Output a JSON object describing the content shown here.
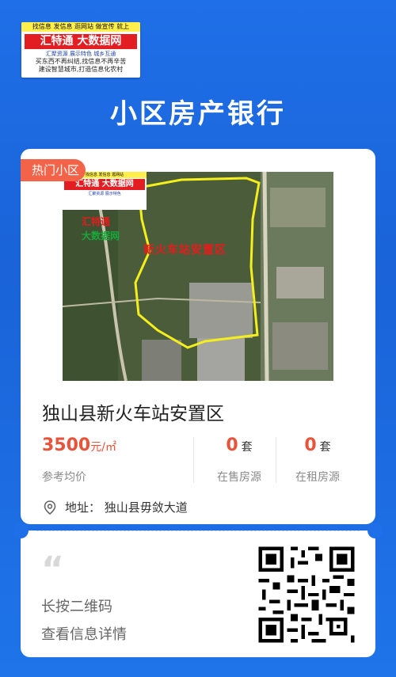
{
  "banner": {
    "line1": "找信息 发信息 逛网站 做宣传 就上",
    "brand": "汇特通 大数据网",
    "line3": "汇聚资源 展示特色 城乡互通",
    "line4": "买东西不再纠结,找信息不再辛苦",
    "line5": "建设智慧城市,打造信息化农村"
  },
  "page_title": "小区房产银行",
  "card": {
    "hot_tag": "热门小区",
    "photo": {
      "banner_top": "找信息 发信息 逛网站",
      "banner_brand": "汇特通 大数据网",
      "banner_sub": "汇聚资源 展示特色",
      "watermark_red": "汇特通",
      "watermark_green": "大数据网",
      "overlay_label": "新火车站安置区"
    },
    "name": "独山县新火车站安置区",
    "price": "3500",
    "price_unit": "元/㎡",
    "price_label": "参考均价",
    "for_sale": {
      "count": "0",
      "unit": "套",
      "label": "在售房源"
    },
    "for_rent": {
      "count": "0",
      "unit": "套",
      "label": "在租房源"
    },
    "address": "地址：  独山县毋敛大道"
  },
  "footer": {
    "quote_mark": "“",
    "hint_line1": "长按二维码",
    "hint_line2": "查看信息详情"
  },
  "colors": {
    "accent": "#e8533a",
    "background": "#1f6fe8",
    "brand_red": "#e21e22",
    "boundary_yellow": "#f4ef1c"
  },
  "icons": {
    "address": "location-pin-icon",
    "quote": "quote-icon",
    "qr": "qr-code"
  }
}
